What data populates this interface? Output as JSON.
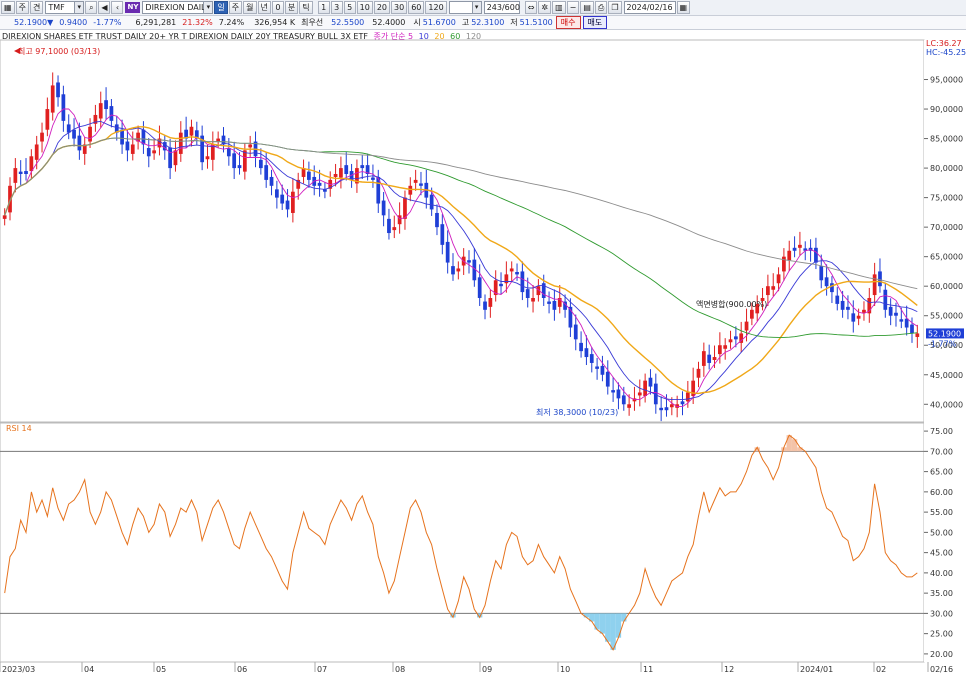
{
  "toolbar1": {
    "period_a": "주",
    "period_b": "견",
    "code": "TMF",
    "exchange_badge": "NY",
    "name": "DIREXION DAILY",
    "active_tab": "일",
    "tabs": [
      "주",
      "월",
      "년",
      "0",
      "분",
      "틱"
    ],
    "intervals": [
      "1",
      "3",
      "5",
      "10",
      "20",
      "30",
      "60",
      "120"
    ],
    "count": "243/600",
    "date": "2024/02/16"
  },
  "toolbar2": {
    "price": "52.1900▼",
    "change": "0.9400",
    "change_pct": "-1.77%",
    "volume": "6,291,281",
    "vol_pct": "21.32%",
    "turnover_pct": "7.24%",
    "amount": "326,954 K",
    "best_label": "최우선",
    "ask": "52.5500",
    "bid": "52.4000",
    "open_label": "시",
    "open": "51.6700",
    "high_label": "고",
    "high": "52.3100",
    "low_label": "저",
    "low": "51.5100",
    "buy": "매수",
    "sell": "매도"
  },
  "chart_title": "DIREXION SHARES ETF TRUST DAILY 20+ YR T  DIREXION DAILY 20Y TREASURY BULL 3X ETF",
  "ma_legend": {
    "label": "종가 단순",
    "periods": [
      "5",
      "10",
      "20",
      "60",
      "120"
    ]
  },
  "colors": {
    "up": "#e02020",
    "down": "#1f3fd6",
    "ma5": "#d01fbf",
    "ma10": "#3a3ad6",
    "ma20": "#f0a818",
    "ma60": "#2f9a2f",
    "ma120": "#8c8c8c",
    "rsi": "#e6731e",
    "rsi_fill_high": "#f4c3a8",
    "rsi_fill_low": "#8fd1ee"
  },
  "annotations": {
    "high": "최고 97,1000 (03/13)",
    "low": "최저 38,3000 (10/23)",
    "split": "액면병합(900.00%)"
  },
  "price_axis_right_top": "LC:36.27",
  "price_axis_right_top2": "HC:-45.25",
  "current_price_tag": "52.1900",
  "current_change_tag": "-1.77%",
  "rsi_label": "RSI 14",
  "x_axis_labels": [
    "2023/03",
    "04",
    "05",
    "06",
    "07",
    "08",
    "09",
    "10",
    "11",
    "12",
    "2024/01",
    "02",
    "02/16"
  ],
  "chart_data": {
    "type": "candlestick",
    "price_ticks": [
      "95,0000",
      "90,0000",
      "85,0000",
      "80,0000",
      "75,0000",
      "70,0000",
      "65,0000",
      "60,0000",
      "55,0000",
      "50,0000",
      "45,0000",
      "40,0000"
    ],
    "price_ylim": [
      37,
      100
    ],
    "rsi_ticks": [
      "75.00",
      "70.00",
      "65.00",
      "60.00",
      "55.00",
      "50.00",
      "45.00",
      "40.00",
      "35.00",
      "30.00",
      "25.00",
      "20.00"
    ],
    "rsi_ylim": [
      18,
      77
    ],
    "rsi_bands": [
      30,
      70
    ],
    "close_path": [
      72,
      77,
      80,
      79,
      79,
      82,
      84,
      86,
      90,
      94,
      92,
      88,
      86,
      85,
      83,
      84,
      87,
      89,
      91,
      90,
      88,
      86,
      84,
      83,
      84,
      86,
      84,
      82,
      83,
      85,
      83,
      80,
      83,
      86,
      85,
      87,
      85,
      81,
      82,
      84,
      85,
      84,
      82,
      80,
      80,
      83,
      84,
      82,
      80,
      78,
      77,
      75,
      74,
      73,
      76,
      78,
      80,
      78,
      77,
      77,
      76,
      78,
      79,
      80,
      79,
      78,
      80,
      80,
      79,
      78,
      74,
      72,
      69,
      70,
      72,
      75,
      77,
      78,
      77,
      75,
      73,
      70,
      67,
      64,
      62,
      63,
      65,
      64,
      61,
      58,
      56,
      58,
      61,
      60,
      62,
      63,
      62,
      59,
      58,
      58,
      60,
      58,
      57,
      56,
      58,
      56,
      53,
      51,
      49,
      48,
      47,
      46,
      45,
      43,
      42,
      41,
      40,
      40,
      41,
      42,
      44,
      43,
      40,
      39,
      39,
      40,
      40,
      40,
      42,
      44,
      46,
      49,
      47,
      48,
      50,
      50,
      51,
      51,
      52,
      54,
      56,
      57,
      58,
      60,
      60,
      62,
      65,
      66,
      66,
      67,
      66,
      66,
      64,
      61,
      60,
      59,
      57,
      56,
      56,
      54,
      55,
      56,
      58,
      62,
      60,
      56,
      55,
      55,
      54,
      53,
      52,
      52
    ],
    "rsi_path": [
      35,
      44,
      46,
      53,
      50,
      60,
      55,
      58,
      54,
      61,
      56,
      53,
      57,
      58,
      60,
      63,
      55,
      52,
      55,
      60,
      58,
      54,
      50,
      47,
      52,
      56,
      54,
      50,
      52,
      57,
      55,
      49,
      52,
      56,
      55,
      58,
      55,
      48,
      52,
      56,
      58,
      55,
      51,
      47,
      46,
      51,
      55,
      52,
      49,
      46,
      44,
      41,
      38,
      36,
      45,
      50,
      55,
      51,
      50,
      49,
      47,
      52,
      55,
      58,
      56,
      53,
      57,
      59,
      55,
      52,
      44,
      40,
      35,
      38,
      44,
      50,
      56,
      58,
      55,
      50,
      47,
      41,
      36,
      31,
      29,
      33,
      39,
      36,
      31,
      29,
      32,
      38,
      43,
      41,
      47,
      50,
      49,
      44,
      42,
      43,
      47,
      44,
      42,
      40,
      44,
      41,
      36,
      33,
      30,
      29,
      28,
      26,
      25,
      23,
      21,
      24,
      28,
      30,
      32,
      35,
      41,
      37,
      34,
      32,
      35,
      38,
      39,
      40,
      44,
      47,
      54,
      60,
      55,
      58,
      61,
      59,
      60,
      60,
      62,
      65,
      69,
      71,
      68,
      66,
      63,
      66,
      71,
      74,
      73,
      71,
      70,
      68,
      66,
      60,
      56,
      55,
      52,
      49,
      48,
      43,
      44,
      46,
      50,
      62,
      55,
      45,
      43,
      42,
      40,
      39,
      39,
      40
    ]
  }
}
